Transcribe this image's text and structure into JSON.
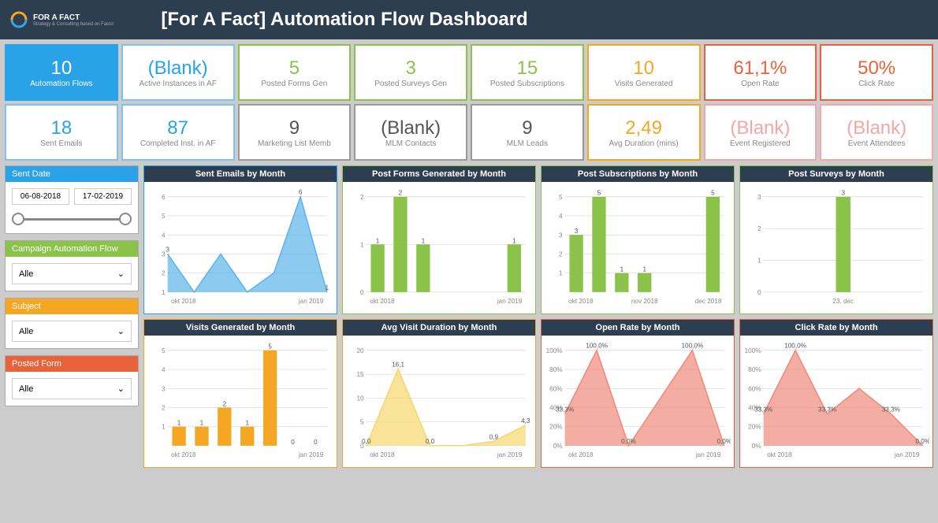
{
  "header": {
    "brand": "FOR A FACT",
    "tagline": "Strategy & Consulting based on Facts!",
    "title": "[For A Fact] Automation Flow Dashboard"
  },
  "kpis": [
    {
      "value": "10",
      "label": "Automation Flows",
      "color": "blue",
      "fill": true
    },
    {
      "value": "(Blank)",
      "label": "Active Instances in AF",
      "color": "blue2",
      "vc": "blue"
    },
    {
      "value": "5",
      "label": "Posted Forms Gen",
      "color": "green",
      "vc": "green"
    },
    {
      "value": "3",
      "label": "Posted Surveys Gen",
      "color": "green",
      "vc": "green"
    },
    {
      "value": "15",
      "label": "Posted Subscriptions",
      "color": "green",
      "vc": "green"
    },
    {
      "value": "10",
      "label": "Visits Generated",
      "color": "orange",
      "vc": "orange"
    },
    {
      "value": "61,1%",
      "label": "Open Rate",
      "color": "red",
      "vc": "red"
    },
    {
      "value": "50%",
      "label": "Click Rate",
      "color": "red",
      "vc": "red"
    },
    {
      "value": "18",
      "label": "Sent Emails",
      "color": "blue2",
      "vc": "blue"
    },
    {
      "value": "87",
      "label": "Completed Inst. in AF",
      "color": "blue2",
      "vc": "blue"
    },
    {
      "value": "9",
      "label": "Marketing List Memb",
      "color": "gray",
      "vc": "gray"
    },
    {
      "value": "(Blank)",
      "label": "MLM Contacts",
      "color": "gray",
      "vc": "gray"
    },
    {
      "value": "9",
      "label": "MLM Leads",
      "color": "gray",
      "vc": "gray"
    },
    {
      "value": "2,49",
      "label": "Avg Duration (mins)",
      "color": "orange",
      "vc": "orange"
    },
    {
      "value": "(Blank)",
      "label": "Event Registered",
      "color": "pink",
      "vc": "pink"
    },
    {
      "value": "(Blank)",
      "label": "Event Attendees",
      "color": "pink",
      "vc": "pink"
    }
  ],
  "filters": {
    "sentDate": {
      "label": "Sent Date",
      "from": "06-08-2018",
      "to": "17-02-2019",
      "color": "blue"
    },
    "campaign": {
      "label": "Campaign Automation Flow",
      "value": "Alle",
      "color": "green"
    },
    "subject": {
      "label": "Subject",
      "value": "Alle",
      "color": "orange"
    },
    "form": {
      "label": "Posted Form",
      "value": "Alle",
      "color": "red"
    }
  },
  "chart_data": [
    {
      "id": "sent-emails",
      "title": "Sent Emails by Month",
      "type": "area",
      "color": "#5bb5e8",
      "xlabels": [
        "okt 2018",
        "jan 2019"
      ],
      "y": [
        3,
        1,
        3,
        1,
        2,
        6,
        1
      ],
      "ylim": [
        1,
        6
      ],
      "labels": [
        "3",
        "",
        "",
        "",
        "",
        "6",
        "1"
      ]
    },
    {
      "id": "post-forms",
      "title": "Post Forms Generated by Month",
      "type": "bar",
      "color": "#8bc34a",
      "xlabels": [
        "okt 2018",
        "jan 2019"
      ],
      "y": [
        1,
        2,
        1,
        0,
        0,
        0,
        1
      ],
      "ylim": [
        0,
        2
      ],
      "labels": [
        "1",
        "2",
        "1",
        "",
        "",
        "",
        "1"
      ]
    },
    {
      "id": "post-subs",
      "title": "Post Subscriptions by Month",
      "type": "bar",
      "color": "#8bc34a",
      "xlabels": [
        "okt 2018",
        "nov 2018",
        "dec 2018"
      ],
      "y": [
        3,
        5,
        1,
        1,
        0,
        0,
        5
      ],
      "ylim": [
        0,
        5
      ],
      "labels": [
        "3",
        "5",
        "1",
        "1",
        "",
        "",
        "5"
      ]
    },
    {
      "id": "post-surveys",
      "title": "Post Surveys by Month",
      "type": "bar",
      "color": "#8bc34a",
      "xlabels": [
        "23. dec"
      ],
      "y": [
        3
      ],
      "ylim": [
        0,
        3
      ],
      "labels": [
        "3"
      ]
    },
    {
      "id": "visits",
      "title": "Visits Generated by Month",
      "type": "bar",
      "color": "#f5a623",
      "xlabels": [
        "okt 2018",
        "jan 2019"
      ],
      "y": [
        1,
        1,
        2,
        1,
        5,
        0,
        0
      ],
      "ylim": [
        0,
        5
      ],
      "labels": [
        "1",
        "1",
        "2",
        "1",
        "5",
        "0",
        "0"
      ]
    },
    {
      "id": "avg-duration",
      "title": "Avg Visit Duration by Month",
      "type": "area",
      "color": "#f5d76e",
      "xlabels": [
        "okt 2018",
        "jan 2019"
      ],
      "y": [
        0.0,
        16.1,
        0.0,
        0,
        0.9,
        4.3
      ],
      "ylim": [
        0,
        20
      ],
      "labels": [
        "0,0",
        "16,1",
        "0,0",
        "",
        "0,9",
        "4,3"
      ]
    },
    {
      "id": "open-rate",
      "title": "Open Rate by Month",
      "type": "area",
      "color": "#f08a7a",
      "xlabels": [
        "okt 2018",
        "jan 2019"
      ],
      "y": [
        33.3,
        100,
        0,
        50,
        100,
        0
      ],
      "ylim": [
        0,
        100
      ],
      "labels": [
        "33,3%",
        "100,0%",
        "0,0%",
        "",
        "100,0%",
        "0,0%"
      ],
      "pct": true
    },
    {
      "id": "click-rate",
      "title": "Click Rate by Month",
      "type": "area",
      "color": "#f08a7a",
      "xlabels": [
        "okt 2018",
        "jan 2019"
      ],
      "y": [
        33.3,
        100,
        33.3,
        60,
        33.3,
        0
      ],
      "ylim": [
        0,
        100
      ],
      "labels": [
        "33,3%",
        "100,0%",
        "33,3%",
        "",
        "33,3%",
        "0,0%"
      ],
      "pct": true
    }
  ],
  "colors": {
    "blue": "#29a2e8",
    "green": "#8bc34a",
    "orange": "#f5a623",
    "red": "#e8623a"
  }
}
